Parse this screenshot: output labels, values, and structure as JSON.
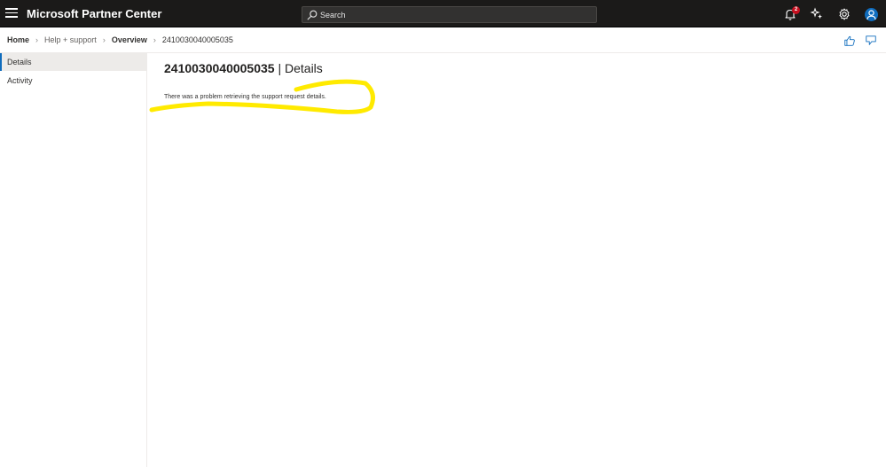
{
  "app": {
    "title": "Microsoft Partner Center"
  },
  "search": {
    "placeholder": "Search"
  },
  "notifications": {
    "count": "2"
  },
  "breadcrumb": {
    "home": "Home",
    "help": "Help + support",
    "overview": "Overview",
    "current": "2410030040005035"
  },
  "sidenav": {
    "items": [
      {
        "label": "Details",
        "selected": true
      },
      {
        "label": "Activity",
        "selected": false
      }
    ]
  },
  "main": {
    "title_id": "2410030040005035",
    "title_suffix": " | Details",
    "error_message": "There was a problem retrieving the support request details."
  },
  "colors": {
    "topbar": "#1b1a19",
    "accent": "#0f6cbd",
    "highlight": "#ffea00",
    "badge": "#c50f1f"
  },
  "icons": [
    "hamburger-icon",
    "search-icon",
    "bell-icon",
    "copilot-icon",
    "gear-icon",
    "avatar-icon",
    "chevron-right-icon",
    "thumbs-up-icon",
    "thumbs-down-icon"
  ]
}
